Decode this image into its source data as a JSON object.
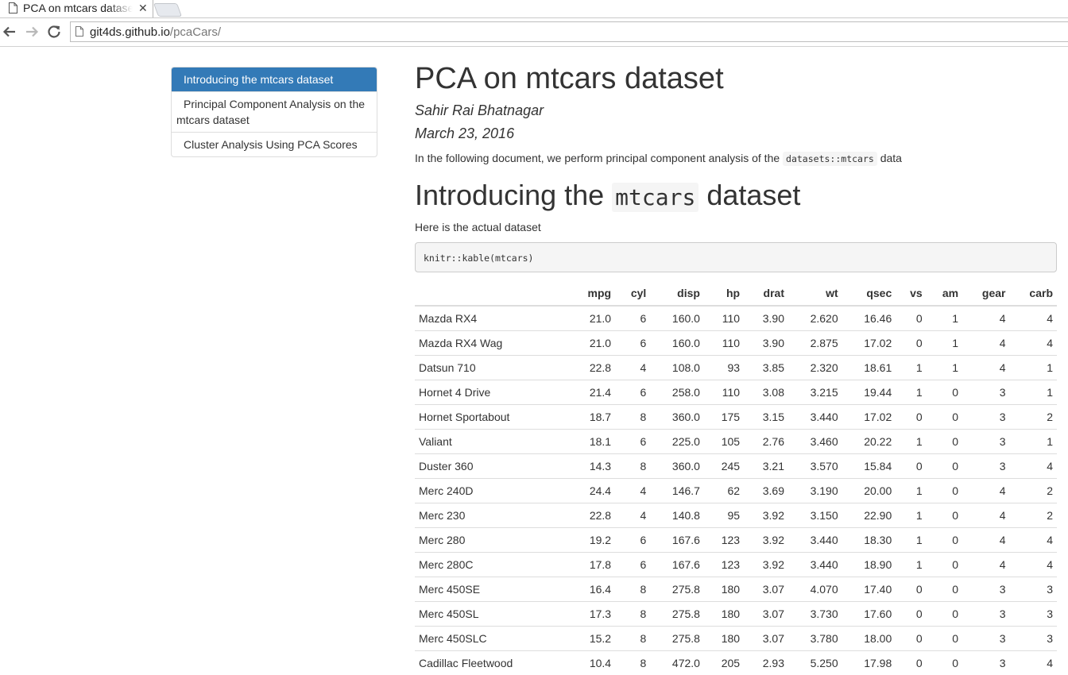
{
  "browser": {
    "tab_title": "PCA on mtcars dataset",
    "tab_close": "✕",
    "url_host": "git4ds.github.io",
    "url_path": "/pcaCars/"
  },
  "toc": {
    "items": [
      {
        "label": "Introducing the mtcars dataset",
        "active": true
      },
      {
        "label": "Principal Component Analysis on the mtcars dataset",
        "active": false
      },
      {
        "label": "Cluster Analysis Using PCA Scores",
        "active": false
      }
    ]
  },
  "doc": {
    "title": "PCA on mtcars dataset",
    "author": "Sahir Rai Bhatnagar",
    "date": "March 23, 2016",
    "intro_before": "In the following document, we perform principal component analysis of the ",
    "intro_code": "datasets::mtcars",
    "intro_after": " data",
    "section_before": "Introducing the ",
    "section_code": "mtcars",
    "section_after": " dataset",
    "para": "Here is the actual dataset",
    "code": "knitr::kable(mtcars)"
  },
  "table": {
    "columns": [
      "",
      "mpg",
      "cyl",
      "disp",
      "hp",
      "drat",
      "wt",
      "qsec",
      "vs",
      "am",
      "gear",
      "carb"
    ],
    "rows": [
      [
        "Mazda RX4",
        "21.0",
        "6",
        "160.0",
        "110",
        "3.90",
        "2.620",
        "16.46",
        "0",
        "1",
        "4",
        "4"
      ],
      [
        "Mazda RX4 Wag",
        "21.0",
        "6",
        "160.0",
        "110",
        "3.90",
        "2.875",
        "17.02",
        "0",
        "1",
        "4",
        "4"
      ],
      [
        "Datsun 710",
        "22.8",
        "4",
        "108.0",
        "93",
        "3.85",
        "2.320",
        "18.61",
        "1",
        "1",
        "4",
        "1"
      ],
      [
        "Hornet 4 Drive",
        "21.4",
        "6",
        "258.0",
        "110",
        "3.08",
        "3.215",
        "19.44",
        "1",
        "0",
        "3",
        "1"
      ],
      [
        "Hornet Sportabout",
        "18.7",
        "8",
        "360.0",
        "175",
        "3.15",
        "3.440",
        "17.02",
        "0",
        "0",
        "3",
        "2"
      ],
      [
        "Valiant",
        "18.1",
        "6",
        "225.0",
        "105",
        "2.76",
        "3.460",
        "20.22",
        "1",
        "0",
        "3",
        "1"
      ],
      [
        "Duster 360",
        "14.3",
        "8",
        "360.0",
        "245",
        "3.21",
        "3.570",
        "15.84",
        "0",
        "0",
        "3",
        "4"
      ],
      [
        "Merc 240D",
        "24.4",
        "4",
        "146.7",
        "62",
        "3.69",
        "3.190",
        "20.00",
        "1",
        "0",
        "4",
        "2"
      ],
      [
        "Merc 230",
        "22.8",
        "4",
        "140.8",
        "95",
        "3.92",
        "3.150",
        "22.90",
        "1",
        "0",
        "4",
        "2"
      ],
      [
        "Merc 280",
        "19.2",
        "6",
        "167.6",
        "123",
        "3.92",
        "3.440",
        "18.30",
        "1",
        "0",
        "4",
        "4"
      ],
      [
        "Merc 280C",
        "17.8",
        "6",
        "167.6",
        "123",
        "3.92",
        "3.440",
        "18.90",
        "1",
        "0",
        "4",
        "4"
      ],
      [
        "Merc 450SE",
        "16.4",
        "8",
        "275.8",
        "180",
        "3.07",
        "4.070",
        "17.40",
        "0",
        "0",
        "3",
        "3"
      ],
      [
        "Merc 450SL",
        "17.3",
        "8",
        "275.8",
        "180",
        "3.07",
        "3.730",
        "17.60",
        "0",
        "0",
        "3",
        "3"
      ],
      [
        "Merc 450SLC",
        "15.2",
        "8",
        "275.8",
        "180",
        "3.07",
        "3.780",
        "18.00",
        "0",
        "0",
        "3",
        "3"
      ],
      [
        "Cadillac Fleetwood",
        "10.4",
        "8",
        "472.0",
        "205",
        "2.93",
        "5.250",
        "17.98",
        "0",
        "0",
        "3",
        "4"
      ]
    ]
  },
  "colors": {
    "toc_active_bg": "#337ab7",
    "text": "#333333",
    "code_bg": "#f5f5f5",
    "border": "#dddddd"
  },
  "icons": {
    "tab_favicon": "page-icon",
    "back": "back-arrow-icon",
    "forward": "forward-arrow-icon",
    "reload": "reload-icon",
    "omnibox_page": "page-icon"
  }
}
